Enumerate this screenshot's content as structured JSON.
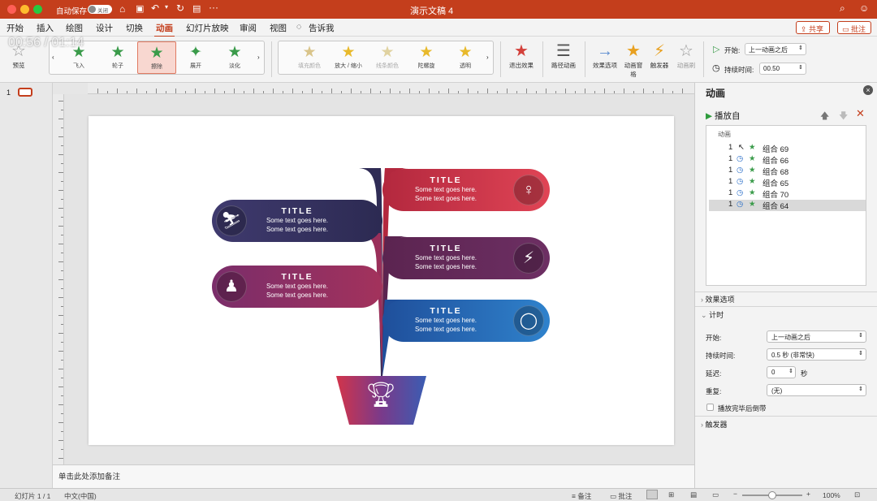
{
  "titlebar": {
    "autosave": "自动保存",
    "autosave_state": "关闭",
    "doc_title": "演示文稿 4"
  },
  "menu": {
    "tabs": [
      "开始",
      "插入",
      "绘图",
      "设计",
      "切换",
      "动画",
      "幻灯片放映",
      "审阅",
      "视图"
    ],
    "tell_me": "告诉我",
    "share": "共享",
    "comments": "批注"
  },
  "ribbon": {
    "preview": "预览",
    "entrance": [
      {
        "label": "飞入",
        "icon": "star"
      },
      {
        "label": "轮子",
        "icon": "star"
      },
      {
        "label": "擦除",
        "icon": "star"
      },
      {
        "label": "展开",
        "icon": "star"
      },
      {
        "label": "淡化",
        "icon": "star"
      }
    ],
    "emphasis": [
      {
        "label": "填充颜色",
        "icon": "star"
      },
      {
        "label": "放大 / 缩小",
        "icon": "star"
      },
      {
        "label": "线条颜色",
        "icon": "star"
      },
      {
        "label": "陀螺旋",
        "icon": "star"
      },
      {
        "label": "透明",
        "icon": "star"
      }
    ],
    "exit": "退出效果",
    "path": "路径动画",
    "effect_options": "效果选项",
    "anim_pane": "动画窗格",
    "trigger": "触发器",
    "anim_brush": "动画刷",
    "start_label": "开始:",
    "start_value": "上一动画之后",
    "duration_label": "持续时间:",
    "duration_value": "00.50"
  },
  "timer": "00:56 / 01:14",
  "slide_number": "1",
  "infographic": {
    "cards": [
      {
        "title": "TITLE",
        "line1": "Some text goes here.",
        "line2": "Some text goes here.",
        "icon": "snowboard-icon"
      },
      {
        "title": "TITLE",
        "line1": "Some text goes here.",
        "line2": "Some text goes here.",
        "icon": "gymnast-icon"
      },
      {
        "title": "TITLE",
        "line1": "Some text goes here.",
        "line2": "Some text goes here.",
        "icon": "weightlifting-icon"
      },
      {
        "title": "TITLE",
        "line1": "Some text goes here.",
        "line2": "Some text goes here.",
        "icon": "runner-icon"
      },
      {
        "title": "TITLE",
        "line1": "Some text goes here.",
        "line2": "Some text goes here.",
        "icon": "jump-rope-icon"
      }
    ],
    "trophy_icon": "trophy-icon"
  },
  "notes_placeholder": "单击此处添加备注",
  "pane": {
    "title": "动画",
    "play_from": "播放自",
    "list_header": "动画",
    "items": [
      {
        "num": "1",
        "name": "组合 69"
      },
      {
        "num": "1",
        "name": "组合 66"
      },
      {
        "num": "1",
        "name": "组合 68"
      },
      {
        "num": "1",
        "name": "组合 65"
      },
      {
        "num": "1",
        "name": "组合 70"
      },
      {
        "num": "1",
        "name": "组合 64"
      }
    ],
    "effect_options": "效果选项",
    "timing": "计时",
    "start_label": "开始:",
    "start_value": "上一动画之后",
    "duration_label": "持续时间:",
    "duration_value": "0.5 秒 (非常快)",
    "delay_label": "延迟:",
    "delay_value": "0",
    "delay_unit": "秒",
    "repeat_label": "重复:",
    "repeat_value": "(无)",
    "rewind": "播放完毕后倒带",
    "triggers": "触发器"
  },
  "status": {
    "slide": "幻灯片 1 / 1",
    "lang": "中文(中国)",
    "notes": "备注",
    "comments": "批注",
    "zoom": "100%"
  },
  "colors": {
    "accent": "#c43e1c"
  }
}
